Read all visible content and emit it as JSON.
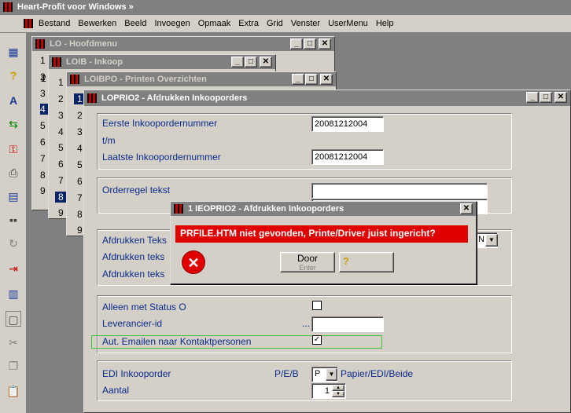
{
  "app": {
    "title": "Heart-Profit voor Windows  »"
  },
  "menubar": {
    "items": [
      "Bestand",
      "Bewerken",
      "Beeld",
      "Invoegen",
      "Opmaak",
      "Extra",
      "Grid",
      "Venster",
      "UserMenu",
      "Help"
    ]
  },
  "windows": {
    "lo": {
      "title": "LO - Hoofdmenu",
      "numbers": [
        "1",
        "2",
        "3",
        "4",
        "5",
        "6",
        "7",
        "8",
        "9"
      ]
    },
    "loib": {
      "title": "LOIB - Inkoop",
      "numbers": [
        "1",
        "2",
        "3",
        "4",
        "5",
        "6",
        "7",
        "8",
        "9"
      ]
    },
    "loibpo": {
      "title": "LOIBPO - Printen Overzichten",
      "numbers": [
        "1",
        "2",
        "3",
        "4",
        "5",
        "6",
        "7",
        "8",
        "9"
      ]
    },
    "lopri": {
      "title": "LOPRIO2 - Afdrukken Inkooporders"
    }
  },
  "form": {
    "eerste_label": "Eerste  Inkoopordernummer",
    "eerste_value": "20081212004",
    "tm_label": "t/m",
    "laatste_label": "Laatste Inkoopordernummer",
    "laatste_value": "20081212004",
    "orderregel_label": "Orderregel tekst",
    "afdrukken_1": "Afdrukken Teks",
    "afdrukken_2": "Afdrukken teks",
    "afdrukken_3": "Afdrukken teks",
    "combo_fragment": "N",
    "status_label": "Alleen met Status O",
    "leverancier_label": "Leverancier-id",
    "leverancier_dots": "...",
    "email_label": "Aut. Emailen naar Kontaktpersonen",
    "email_checked": "✓",
    "edi_label": "EDI Inkooporder",
    "edi_pe": "P/E/B",
    "edi_value": "P",
    "edi_desc": "Papier/EDI/Beide",
    "aantal_label": "Aantal",
    "aantal_value": "1"
  },
  "dialog": {
    "title": "1 IEOPRIO2 - Afdrukken Inkooporders",
    "message": "PRFILE.HTM niet gevonden, Printe/Driver juist ingericht?",
    "door_label": "Door",
    "door_sub": "Enter",
    "help_glyph": "?"
  },
  "toolbar_icons": [
    "calendar-icon",
    "help-icon",
    "spell-icon",
    "export-icon",
    "key-icon",
    "print-icon",
    "window-icon",
    "grid-icon",
    "refresh-icon",
    "exit-icon",
    "chart-icon",
    "frame-icon",
    "cut-icon",
    "copy-icon",
    "paste-icon"
  ],
  "colors": {
    "error_bg": "#e00000",
    "title_active": "#808080",
    "window_bg": "#d4d0c8"
  }
}
